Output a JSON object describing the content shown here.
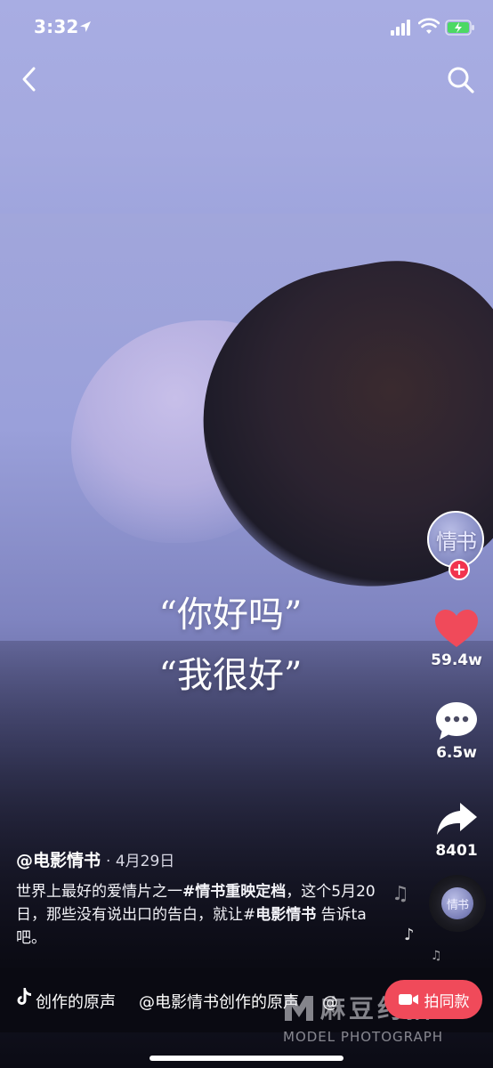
{
  "status_bar": {
    "time": "3:32"
  },
  "video": {
    "subtitles": [
      "“你好吗”",
      "“我很好”"
    ]
  },
  "author": {
    "avatar_text": "情书",
    "handle": "@电影情书",
    "date": "· 4月29日"
  },
  "actions": {
    "likes": "59.4w",
    "comments": "6.5w",
    "shares": "8401"
  },
  "description": {
    "part1": "世界上最好的爱情片之一",
    "tag1": "#情书重映定档",
    "part2": "，这个5月20日，那些没有说出口的告白，就让#",
    "tag2": "电影情书",
    "part3": " 告诉ta吧。"
  },
  "music": {
    "ticker_items": [
      "创作的原声",
      "@电影情书创作的原声",
      "@"
    ],
    "disc_text": "情书"
  },
  "shoot_button": {
    "label": "拍同款"
  },
  "watermark": {
    "title": "麻豆约拍",
    "subtitle": "MODEL PHOTOGRAPH"
  },
  "colors": {
    "accent": "#f1344f",
    "like": "#f04a5a",
    "sky": "#a4a9df"
  },
  "icons": {
    "back": "chevron-left-icon",
    "search": "search-icon",
    "like": "heart-icon",
    "comment": "comment-bubble-icon",
    "share": "share-arrow-icon",
    "music": "music-note-icon",
    "camera": "camera-icon"
  }
}
